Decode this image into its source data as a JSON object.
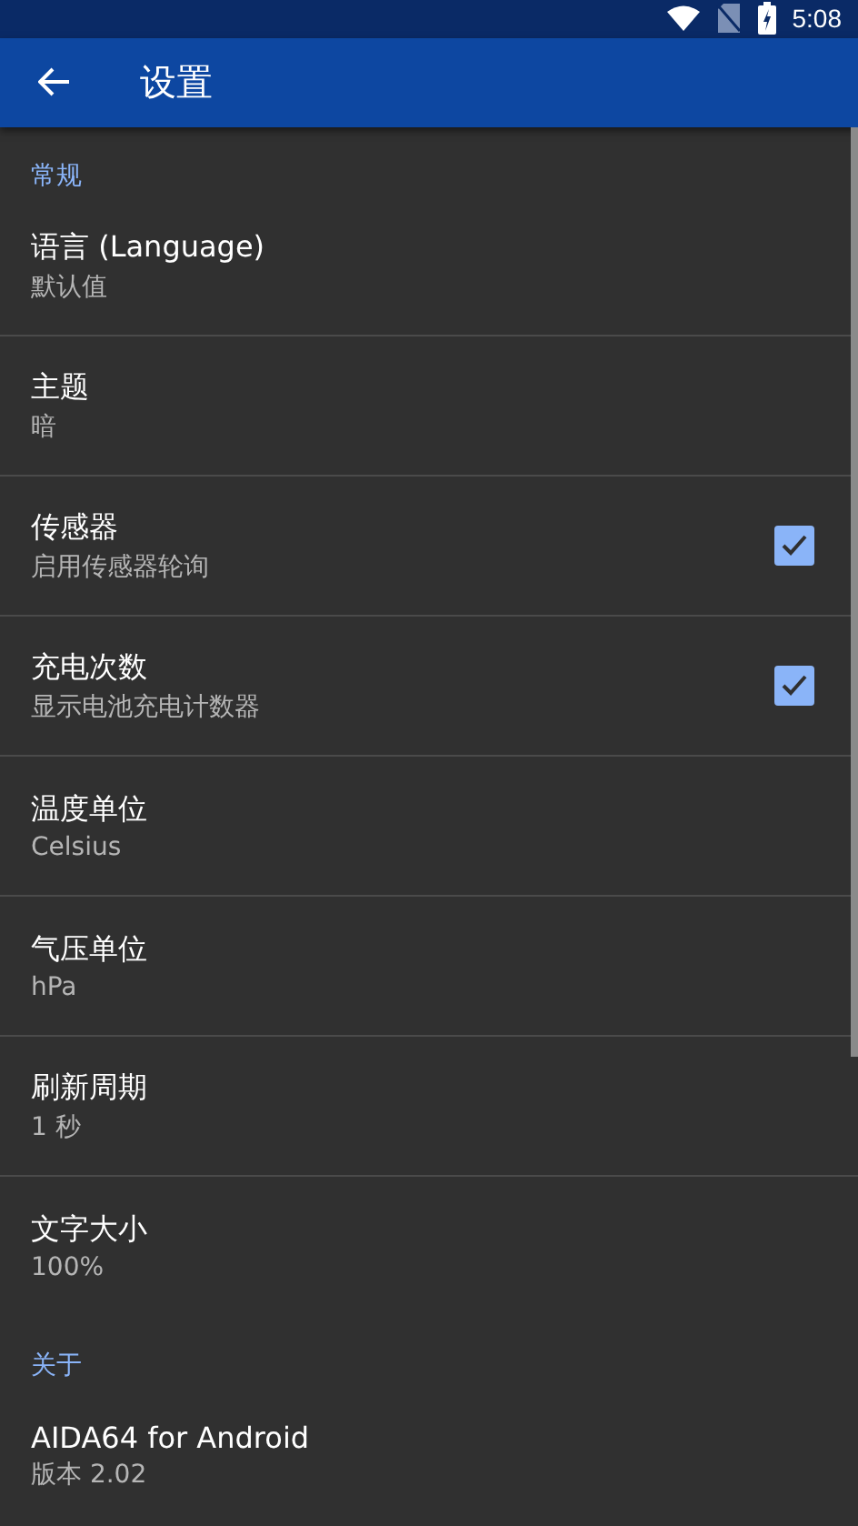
{
  "status_bar": {
    "time": "5:08"
  },
  "app_bar": {
    "title": "设置"
  },
  "sections": [
    {
      "header": "常规",
      "items": [
        {
          "kind": "plain",
          "title": "语言 (Language)",
          "summary": "默认值"
        },
        {
          "kind": "plain",
          "title": "主题",
          "summary": "暗"
        },
        {
          "kind": "checkbox",
          "title": "传感器",
          "summary": "启用传感器轮询",
          "checked": true
        },
        {
          "kind": "checkbox",
          "title": "充电次数",
          "summary": "显示电池充电计数器",
          "checked": true
        },
        {
          "kind": "plain",
          "title": "温度单位",
          "summary": "Celsius"
        },
        {
          "kind": "plain",
          "title": "气压单位",
          "summary": "hPa"
        },
        {
          "kind": "plain",
          "title": "刷新周期",
          "summary": "1 秒"
        },
        {
          "kind": "plain",
          "title": "文字大小",
          "summary": "100%"
        }
      ]
    },
    {
      "header": "关于",
      "items": [
        {
          "kind": "plain",
          "title": "AIDA64 for Android",
          "summary": "版本 2.02"
        }
      ]
    }
  ]
}
